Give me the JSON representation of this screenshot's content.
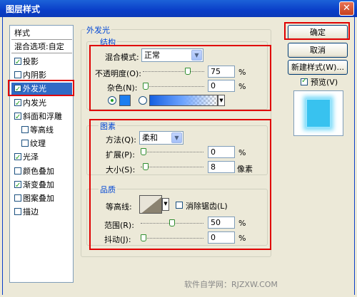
{
  "window": {
    "title": "图层样式",
    "close_glyph": "✕"
  },
  "stylelist": {
    "header": "样式",
    "blend_options": "混合选项:自定",
    "items": [
      {
        "label": "投影",
        "checked": true
      },
      {
        "label": "内阴影",
        "checked": false
      },
      {
        "label": "外发光",
        "checked": true,
        "selected": true
      },
      {
        "label": "内发光",
        "checked": true
      },
      {
        "label": "斜面和浮雕",
        "checked": true
      },
      {
        "label": "等高线",
        "checked": false,
        "sub": true
      },
      {
        "label": "纹理",
        "checked": false,
        "sub": true
      },
      {
        "label": "光泽",
        "checked": true
      },
      {
        "label": "颜色叠加",
        "checked": false
      },
      {
        "label": "渐变叠加",
        "checked": true
      },
      {
        "label": "图案叠加",
        "checked": false
      },
      {
        "label": "描边",
        "checked": false
      }
    ]
  },
  "outer_glow": {
    "group_title": "外发光",
    "structure": {
      "title": "结构",
      "blend_mode_label": "混合模式:",
      "blend_mode_value": "正常",
      "opacity_label": "不透明度(O):",
      "opacity_value": "75",
      "opacity_unit": "%",
      "opacity_level": 0.75,
      "noise_label": "杂色(N):",
      "noise_value": "0",
      "noise_unit": "%",
      "noise_level": 0.0,
      "glow_color": "#1c7ef0"
    },
    "elements": {
      "title": "图素",
      "technique_label": "方法(Q):",
      "technique_value": "柔和",
      "spread_label": "扩展(P):",
      "spread_value": "0",
      "spread_unit": "%",
      "spread_level": 0.0,
      "size_label": "大小(S):",
      "size_value": "8",
      "size_unit": "像素",
      "size_level": 0.04
    },
    "quality": {
      "title": "品质",
      "contour_label": "等高线:",
      "antialias_label": "消除锯齿(L)",
      "antialias_checked": false,
      "range_label": "范围(R):",
      "range_value": "50",
      "range_unit": "%",
      "range_level": 0.5,
      "jitter_label": "抖动(J):",
      "jitter_value": "0",
      "jitter_unit": "%",
      "jitter_level": 0.0
    }
  },
  "buttons": {
    "ok": "确定",
    "cancel": "取消",
    "new_style": "新建样式(W)...",
    "preview_label": "预览(V)",
    "preview_checked": true
  },
  "watermark": "软件自学网：RJZXW.COM"
}
